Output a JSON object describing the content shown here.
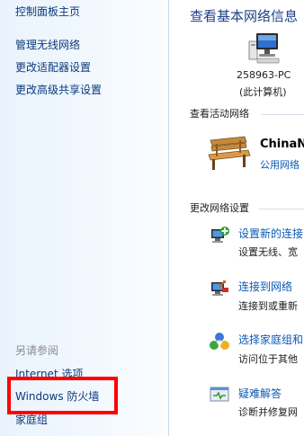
{
  "sidebar": {
    "home_link": "控制面板主页",
    "links": [
      "管理无线网络",
      "更改适配器设置",
      "更改高级共享设置"
    ],
    "see_also_label": "另请参阅",
    "see_also_links": [
      "Internet 选项",
      "Windows 防火墙",
      "家庭组"
    ]
  },
  "main": {
    "title": "查看基本网络信息",
    "computer": {
      "name": "258963-PC",
      "label": "(此计算机)"
    },
    "active_networks_label": "查看活动网络",
    "network": {
      "name": "ChinaNe",
      "type": "公用网络"
    },
    "change_settings_label": "更改网络设置",
    "tasks": [
      {
        "title": "设置新的连接",
        "desc": "设置无线、宽"
      },
      {
        "title": "连接到网络",
        "desc": "连接到或重新"
      },
      {
        "title": "选择家庭组和",
        "desc": "访问位于其他"
      },
      {
        "title": "疑难解答",
        "desc": "诊断并修复网"
      }
    ]
  },
  "annotation_color": "#ff0000"
}
